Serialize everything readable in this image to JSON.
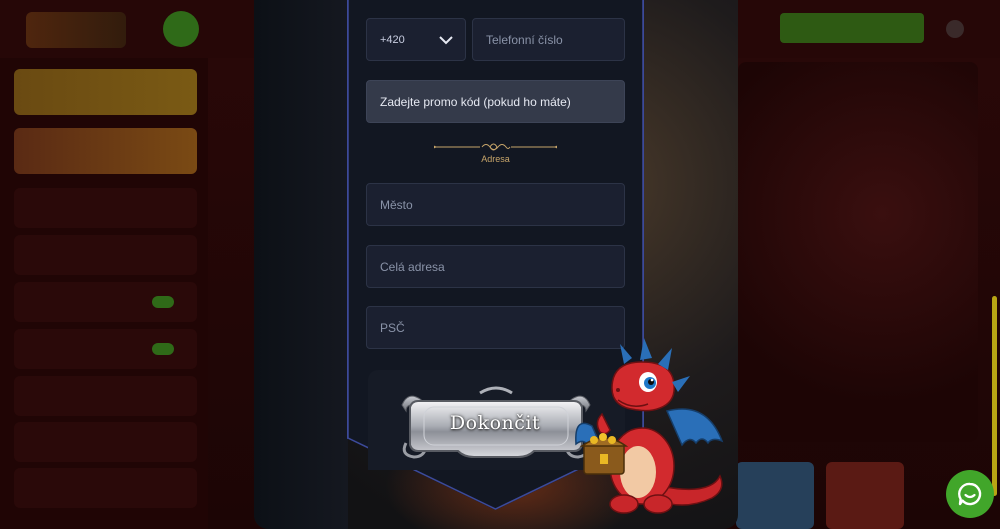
{
  "form": {
    "country_code": "+420",
    "phone_placeholder": "Telefonní číslo",
    "promo_placeholder": "Zadejte promo kód (pokud ho máte)",
    "address_section_label": "Adresa",
    "city_placeholder": "Město",
    "address_placeholder": "Celá adresa",
    "zip_placeholder": "PSČ",
    "submit_label": "Dokončit"
  },
  "icons": {
    "dropdown": "chevron-down-icon",
    "chat": "chat-icon",
    "mascot": "dragon-mascot"
  },
  "colors": {
    "panel_background": "#121722",
    "panel_border": "#3c4a9a",
    "field_background": "#1b2030",
    "section_label": "#c7a56a",
    "chat_button": "#41a62a",
    "scrollbar": "#b8a514"
  }
}
